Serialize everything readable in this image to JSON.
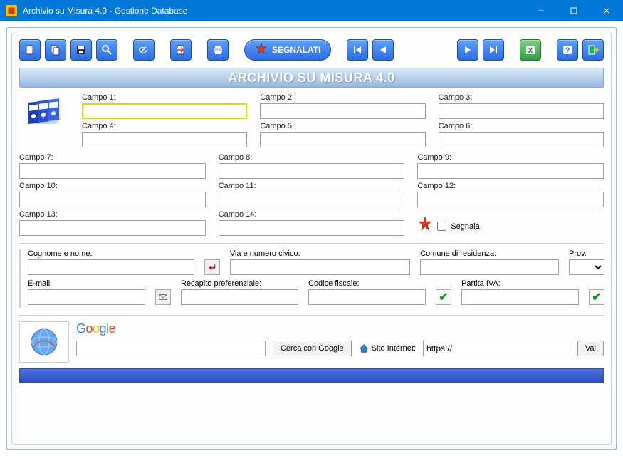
{
  "window": {
    "title": "Archivio su Misura 4.0 - Gestione Database"
  },
  "toolbar": {
    "segnalati_label": "SEGNALATI"
  },
  "banner": "ARCHIVIO SU MISURA 4.0",
  "fields": {
    "c1_label": "Campo 1:",
    "c2_label": "Campo 2:",
    "c3_label": "Campo 3:",
    "c4_label": "Campo 4:",
    "c5_label": "Campo 5:",
    "c6_label": "Campo 6:",
    "c7_label": "Campo 7:",
    "c8_label": "Campo 8:",
    "c9_label": "Campo 9:",
    "c10_label": "Campo 10:",
    "c11_label": "Campo 11:",
    "c12_label": "Campo 12:",
    "c13_label": "Campo 13:",
    "c14_label": "Campo 14:",
    "segnala_label": "Segnala"
  },
  "contact": {
    "name_label": "Cognome e nome:",
    "address_label": "Via e numero civico:",
    "city_label": "Comune di residenza:",
    "prov_label": "Prov.",
    "email_label": "E-mail:",
    "recapito_label": "Recapito preferenziale:",
    "fiscale_label": "Codice fiscale:",
    "piva_label": "Partita IVA:"
  },
  "web": {
    "google_search_label": "Cerca con Google",
    "site_label": "Sito Internet:",
    "site_value": "https://",
    "go_label": "Vai"
  }
}
